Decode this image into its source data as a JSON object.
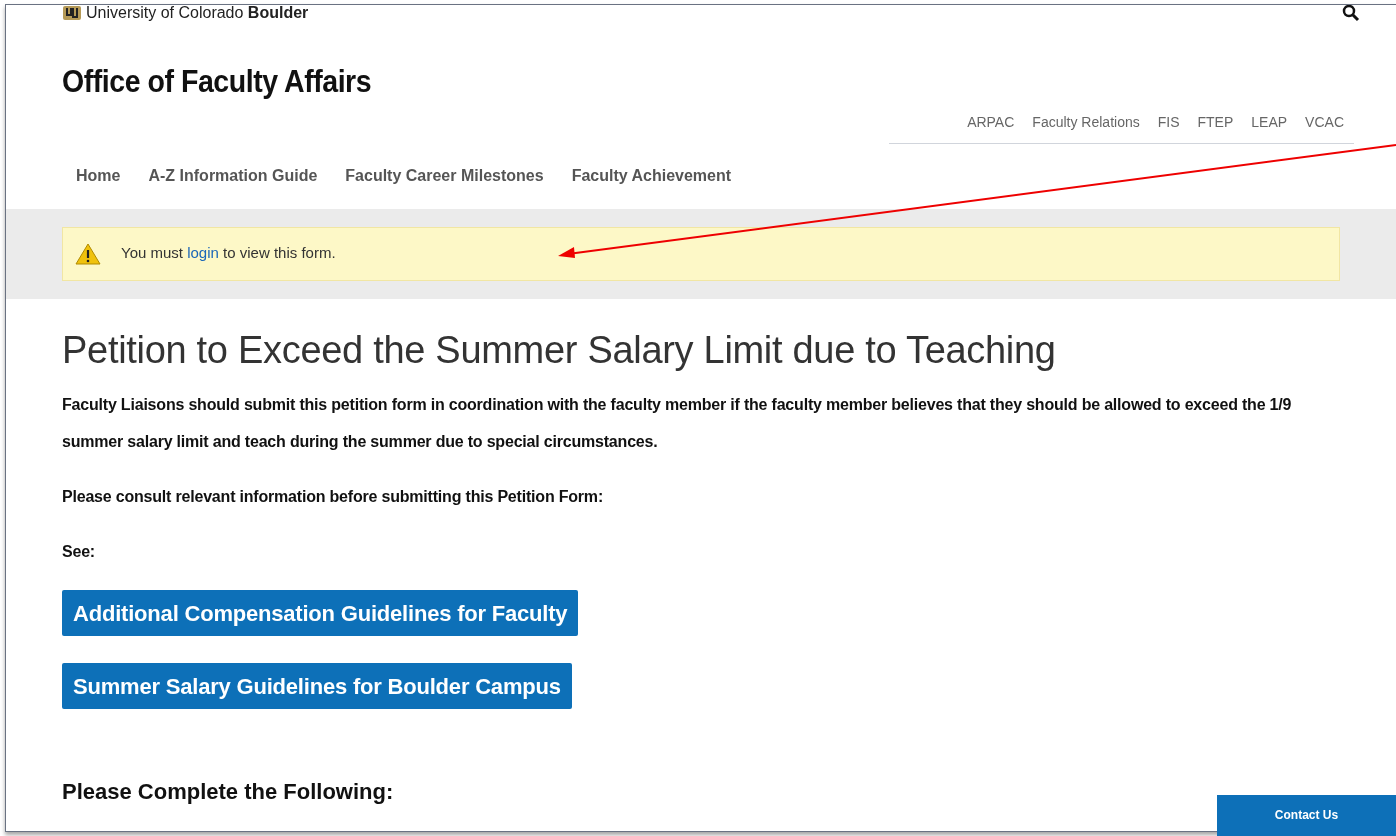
{
  "brand": {
    "university": "University of Colorado **Boulder**",
    "site_title": "Office of Faculty Affairs"
  },
  "utility_links": [
    "ARPAC",
    "Faculty Relations",
    "FIS",
    "FTEP",
    "LEAP",
    "VCAC"
  ],
  "main_nav": [
    "Home",
    "A-Z Information Guide",
    "Faculty Career Milestones",
    "Faculty Achievement"
  ],
  "alert": {
    "before": "You must ",
    "link": "login",
    "after": " to view this form."
  },
  "page_title": "Petition to Exceed the Summer Salary Limit due to Teaching",
  "paragraphs": [
    "Faculty Liaisons should submit this petition form in coordination with the faculty member if the faculty member believes that they should be allowed to exceed the 1/9 summer salary limit and teach during the summer due to special circumstances.",
    "Please consult relevant information before submitting this Petition Form:",
    "See:"
  ],
  "buttons": [
    "Additional Compensation Guidelines for Faculty",
    "Summer Salary Guidelines for Boulder Campus"
  ],
  "section_heading": "Please Complete the Following:",
  "contact_button": "Contact Us"
}
